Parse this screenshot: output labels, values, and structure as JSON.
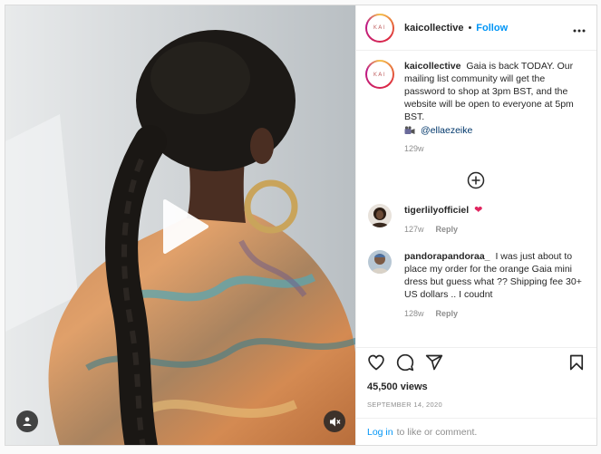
{
  "post": {
    "username": "kaicollective",
    "avatar_label": "KAI",
    "follow_label": "Follow",
    "separator": "•",
    "more_label": "•••"
  },
  "caption": {
    "username": "kaicollective",
    "text": "Gaia is back TODAY. Our mailing list community will get the password to shop at 3pm BST, and the website will be open to everyone at 5pm BST.",
    "credit_icon": "movie-camera-emoji",
    "credit_mention": "@ellaezeike",
    "time": "129w"
  },
  "comments": [
    {
      "username": "tigerlilyofficiel",
      "text": "",
      "emoji": "❤",
      "time": "127w",
      "reply_label": "Reply"
    },
    {
      "username": "pandorapandoraa_",
      "text": "I was just about to place my order for the orange Gaia mini dress but guess what ?? Shipping fee 30+ US dollars .. I coudnt",
      "time": "128w",
      "reply_label": "Reply"
    }
  ],
  "actions": {
    "icons": [
      "heart-icon",
      "comment-icon",
      "share-icon",
      "bookmark-icon"
    ]
  },
  "stats": {
    "views": "45,500 views",
    "date": "September 14, 2020"
  },
  "footer": {
    "login_label": "Log in",
    "rest_label": "to like or comment."
  },
  "media": {
    "icons": [
      "play-icon",
      "user-tag-icon",
      "mute-icon"
    ]
  },
  "colors": {
    "accent": "#0095f6",
    "mention": "#00376b",
    "muted": "#8e8e8e",
    "heart": "#e0245e"
  }
}
